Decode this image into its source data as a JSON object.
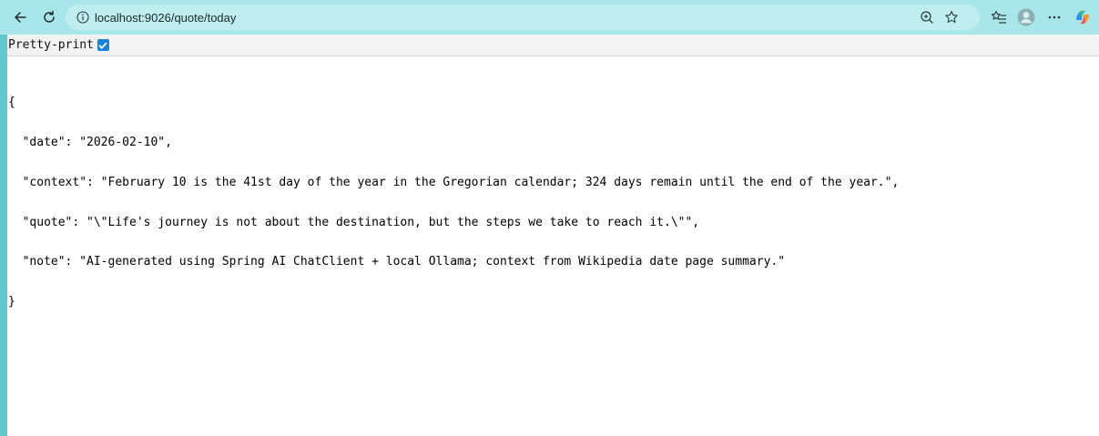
{
  "browser": {
    "url": "localhost:9026/quote/today",
    "colors": {
      "frame": "#5fc8cf",
      "toolbar": "#a8e6e9",
      "address_bar": "#bfeef0",
      "checkbox": "#1a85d6"
    },
    "icons": {
      "back": "back-arrow-icon",
      "refresh": "refresh-icon",
      "site_info": "info-icon",
      "zoom": "zoom-in-icon",
      "favorite": "star-icon",
      "favorites_bar": "favorites-list-icon",
      "profile": "profile-avatar-icon",
      "menu": "more-options-icon",
      "copilot": "copilot-icon"
    }
  },
  "viewer": {
    "pretty_print_label": "Pretty-print",
    "pretty_print_checked": true,
    "open_brace": "{",
    "close_brace": "}",
    "lines": [
      "\"date\": \"2026-02-10\",",
      "\"context\": \"February 10 is the 41st day of the year in the Gregorian calendar; 324 days remain until the end of the year.\",",
      "\"quote\": \"\\\"Life's journey is not about the destination, but the steps we take to reach it.\\\"\",",
      "\"note\": \"AI-generated using Spring AI ChatClient + local Ollama; context from Wikipedia date page summary.\""
    ]
  }
}
